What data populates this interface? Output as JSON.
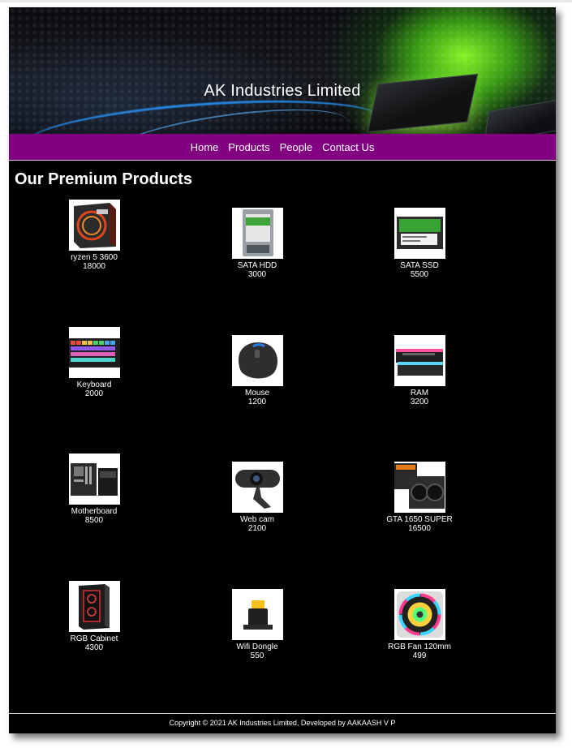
{
  "header": {
    "site_title": "AK Industries Limited"
  },
  "nav": {
    "items": [
      {
        "label": "Home"
      },
      {
        "label": "Products"
      },
      {
        "label": "People"
      },
      {
        "label": "Contact Us"
      }
    ],
    "background_color": "#800080"
  },
  "main": {
    "heading": "Our Premium Products",
    "products": [
      {
        "name": "ryzen 5 3600",
        "price": "18000",
        "icon": "cpu-box-icon"
      },
      {
        "name": "SATA HDD",
        "price": "3000",
        "icon": "hard-drive-icon"
      },
      {
        "name": "SATA SSD",
        "price": "5500",
        "icon": "ssd-icon"
      },
      {
        "name": "Keyboard",
        "price": "2000",
        "icon": "keyboard-icon"
      },
      {
        "name": "Mouse",
        "price": "1200",
        "icon": "mouse-icon"
      },
      {
        "name": "RAM",
        "price": "3200",
        "icon": "ram-icon"
      },
      {
        "name": "Motherboard",
        "price": "8500",
        "icon": "motherboard-icon"
      },
      {
        "name": "Web cam",
        "price": "2100",
        "icon": "webcam-icon"
      },
      {
        "name": "GTA 1650 SUPER",
        "price": "16500",
        "icon": "graphics-card-icon"
      },
      {
        "name": "RGB Cabinet",
        "price": "4300",
        "icon": "pc-cabinet-icon"
      },
      {
        "name": "Wifi Dongle",
        "price": "550",
        "icon": "wifi-dongle-icon"
      },
      {
        "name": "RGB Fan 120mm",
        "price": "499",
        "icon": "rgb-fan-icon"
      }
    ]
  },
  "footer": {
    "copyright": "Copyright © 2021 AK Industries Limited, Developed by AAKAASH V P"
  }
}
